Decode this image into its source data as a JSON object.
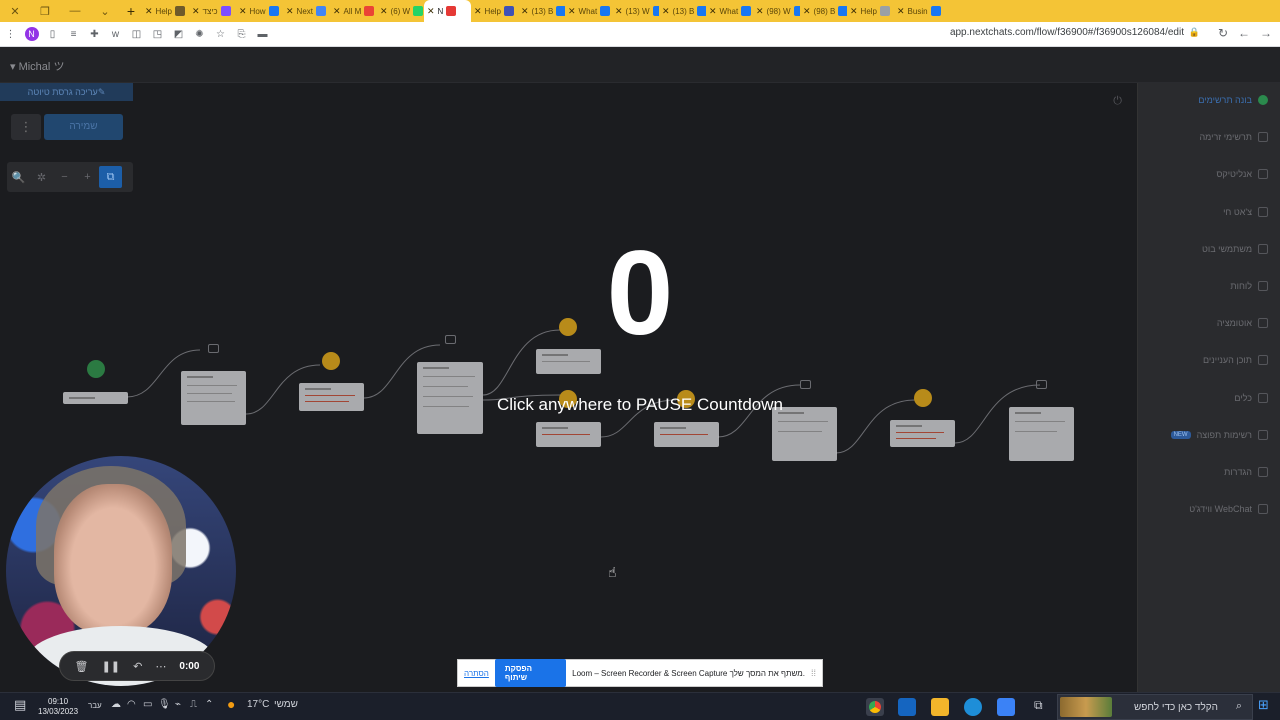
{
  "browser": {
    "tabs": [
      {
        "label": "Help",
        "active": false,
        "fav": "#6e5a2a"
      },
      {
        "label": "כיצד",
        "active": false,
        "fav": "#7c4dff"
      },
      {
        "label": "How",
        "active": false,
        "fav": "#1877f2"
      },
      {
        "label": "Next",
        "active": false,
        "fav": "#4285f4"
      },
      {
        "label": "All M",
        "active": false,
        "fav": "#ea4335"
      },
      {
        "label": "(6) W",
        "active": false,
        "fav": "#25d366"
      },
      {
        "label": "N",
        "active": true,
        "fav": "#e53935"
      },
      {
        "label": "Help",
        "active": false,
        "fav": "#3f51b5"
      },
      {
        "label": "(13) B",
        "active": false,
        "fav": "#1877f2"
      },
      {
        "label": "What",
        "active": false,
        "fav": "#1877f2"
      },
      {
        "label": "(13) W",
        "active": false,
        "fav": "#1877f2"
      },
      {
        "label": "(13) B",
        "active": false,
        "fav": "#1877f2"
      },
      {
        "label": "What",
        "active": false,
        "fav": "#1877f2"
      },
      {
        "label": "(98) W",
        "active": false,
        "fav": "#1877f2"
      },
      {
        "label": "(98) B",
        "active": false,
        "fav": "#1877f2"
      },
      {
        "label": "Help",
        "active": false,
        "fav": "#9aa0a6"
      },
      {
        "label": "Busin",
        "active": false,
        "fav": "#1877f2"
      }
    ],
    "new_tab": "+",
    "url": "app.nextchats.com/flow/f36900#/f36900s126084/edit",
    "profile_initial": "N"
  },
  "app": {
    "username": "Michal",
    "edit_bar": "עריכה גרסת טיוטה",
    "more_label": "⋮",
    "save_label": "שמירה",
    "zoom_tools": [
      "🔍",
      "✲",
      "−",
      "+",
      "⧉"
    ],
    "sidebar": [
      {
        "label": "בונה תרשימים",
        "active": true
      },
      {
        "label": "תרשימי זרימה",
        "active": false
      },
      {
        "label": "אנליטיקס",
        "active": false
      },
      {
        "label": "צ'אט חי",
        "active": false
      },
      {
        "label": "משתמשי בוט",
        "active": false
      },
      {
        "label": "לוחות",
        "active": false
      },
      {
        "label": "אוטומציה",
        "active": false
      },
      {
        "label": "תוכן העניינים",
        "active": false
      },
      {
        "label": "כלים",
        "active": false
      },
      {
        "label": "רשימות תפוצה",
        "active": false,
        "badge": "NEW"
      },
      {
        "label": "הגדרות",
        "active": false
      },
      {
        "label": "WebChat ווידג'ט",
        "active": false
      }
    ]
  },
  "overlay": {
    "countdown": "0",
    "message": "Click anywhere to PAUSE Countdown"
  },
  "recorder": {
    "time": "0:00",
    "controls": [
      "🗑",
      "❚❚",
      "↶",
      "⋯"
    ]
  },
  "loom": {
    "hide_label": "הסתרה",
    "stop_label": "הפסקת שיתוף",
    "message": "Loom – Screen Recorder & Screen Capture משתף את המסך שלך."
  },
  "taskbar": {
    "time": "09:10",
    "date": "13/03/2023",
    "lang": "עבר",
    "weather_temp": "17°C",
    "weather_label": "שמשי",
    "search_placeholder": "הקלד כאן כדי לחפש"
  }
}
